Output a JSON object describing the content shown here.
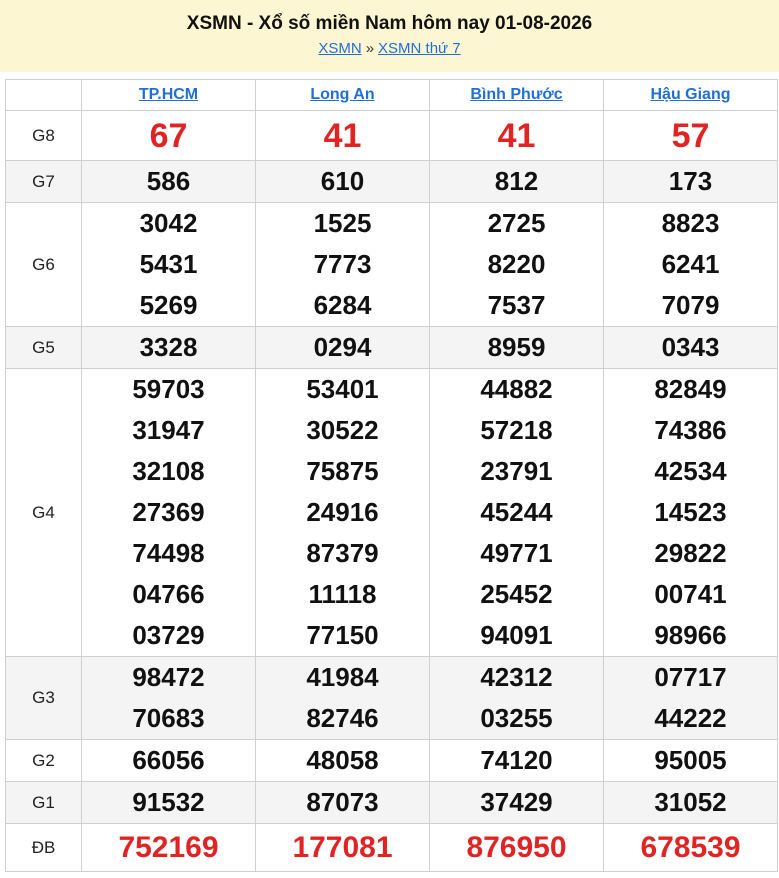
{
  "header": {
    "title": "XSMN - Xổ số miền Nam hôm nay 01-08-2026",
    "crumb_1": "XSMN",
    "separator": "»",
    "crumb_2": "XSMN thứ 7"
  },
  "provinces": [
    "TP.HCM",
    "Long An",
    "Bình Phước",
    "Hậu Giang"
  ],
  "prizes": [
    {
      "label": "G8",
      "values": [
        [
          "67"
        ],
        [
          "41"
        ],
        [
          "41"
        ],
        [
          "57"
        ]
      ]
    },
    {
      "label": "G7",
      "values": [
        [
          "586"
        ],
        [
          "610"
        ],
        [
          "812"
        ],
        [
          "173"
        ]
      ]
    },
    {
      "label": "G6",
      "values": [
        [
          "3042",
          "5431",
          "5269"
        ],
        [
          "1525",
          "7773",
          "6284"
        ],
        [
          "2725",
          "8220",
          "7537"
        ],
        [
          "8823",
          "6241",
          "7079"
        ]
      ]
    },
    {
      "label": "G5",
      "values": [
        [
          "3328"
        ],
        [
          "0294"
        ],
        [
          "8959"
        ],
        [
          "0343"
        ]
      ]
    },
    {
      "label": "G4",
      "values": [
        [
          "59703",
          "31947",
          "32108",
          "27369",
          "74498",
          "04766",
          "03729"
        ],
        [
          "53401",
          "30522",
          "75875",
          "24916",
          "87379",
          "11118",
          "77150"
        ],
        [
          "44882",
          "57218",
          "23791",
          "45244",
          "49771",
          "25452",
          "94091"
        ],
        [
          "82849",
          "74386",
          "42534",
          "14523",
          "29822",
          "00741",
          "98966"
        ]
      ]
    },
    {
      "label": "G3",
      "values": [
        [
          "98472",
          "70683"
        ],
        [
          "41984",
          "82746"
        ],
        [
          "42312",
          "03255"
        ],
        [
          "07717",
          "44222"
        ]
      ]
    },
    {
      "label": "G2",
      "values": [
        [
          "66056"
        ],
        [
          "48058"
        ],
        [
          "74120"
        ],
        [
          "95005"
        ]
      ]
    },
    {
      "label": "G1",
      "values": [
        [
          "91532"
        ],
        [
          "87073"
        ],
        [
          "37429"
        ],
        [
          "31052"
        ]
      ]
    },
    {
      "label": "ĐB",
      "values": [
        [
          "752169"
        ],
        [
          "177081"
        ],
        [
          "876950"
        ],
        [
          "678539"
        ]
      ]
    }
  ],
  "colors": {
    "header_bg": "#fdf6d3",
    "link": "#1f6fd6",
    "highlight_red": "#e02424",
    "alt_row": "#f4f4f4"
  }
}
